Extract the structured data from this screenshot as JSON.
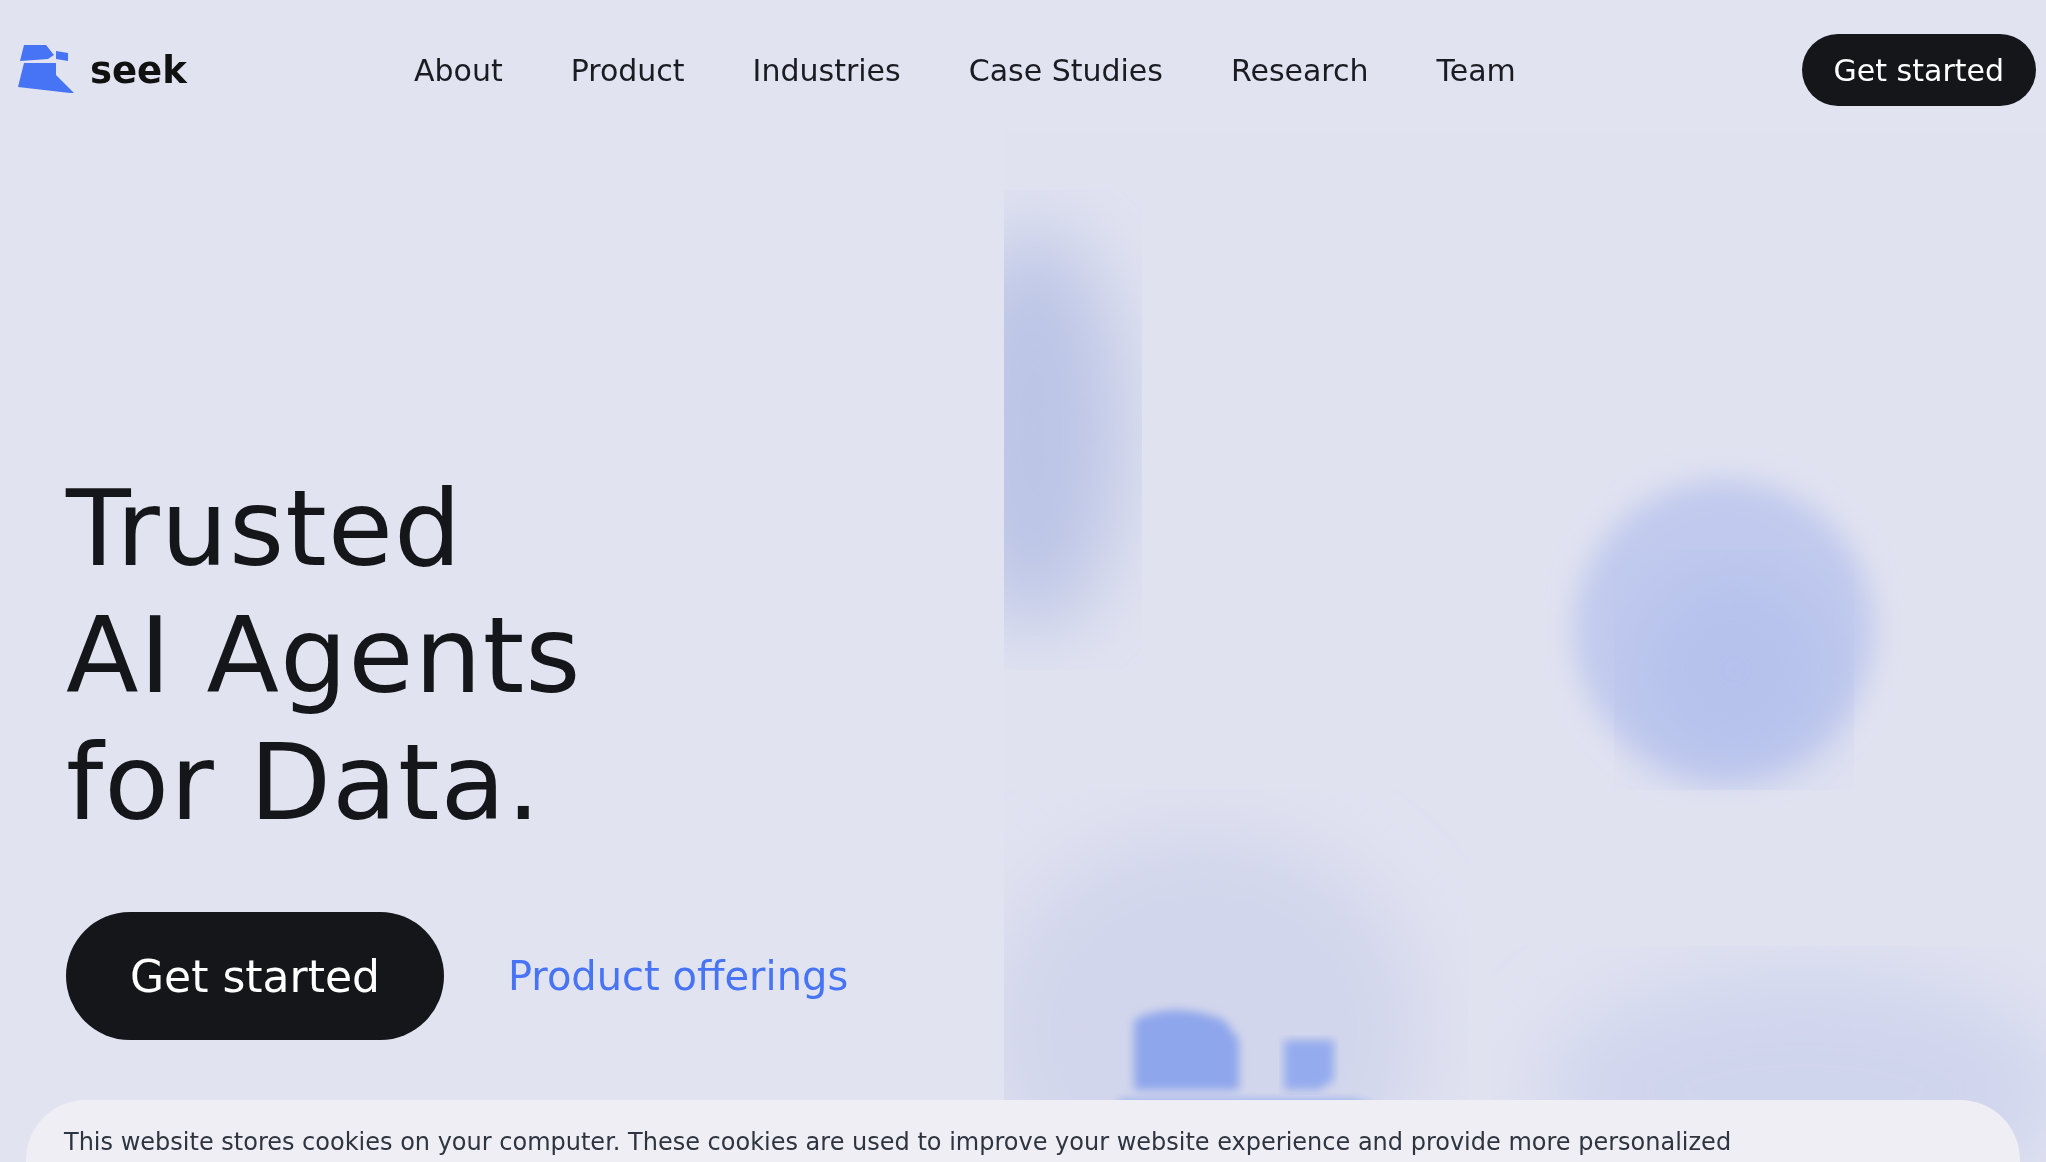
{
  "header": {
    "logo": "seek",
    "nav": [
      "About",
      "Product",
      "Industries",
      "Case Studies",
      "Research",
      "Team"
    ],
    "cta": "Get started"
  },
  "hero": {
    "headline": [
      "Trusted",
      "AI Agents",
      "for Data."
    ],
    "primary_button": "Get started",
    "secondary_link": "Product offerings"
  },
  "cookie_banner": {
    "text": "This website stores cookies on your computer. These cookies are used to improve your website experience and provide more personalized"
  }
}
